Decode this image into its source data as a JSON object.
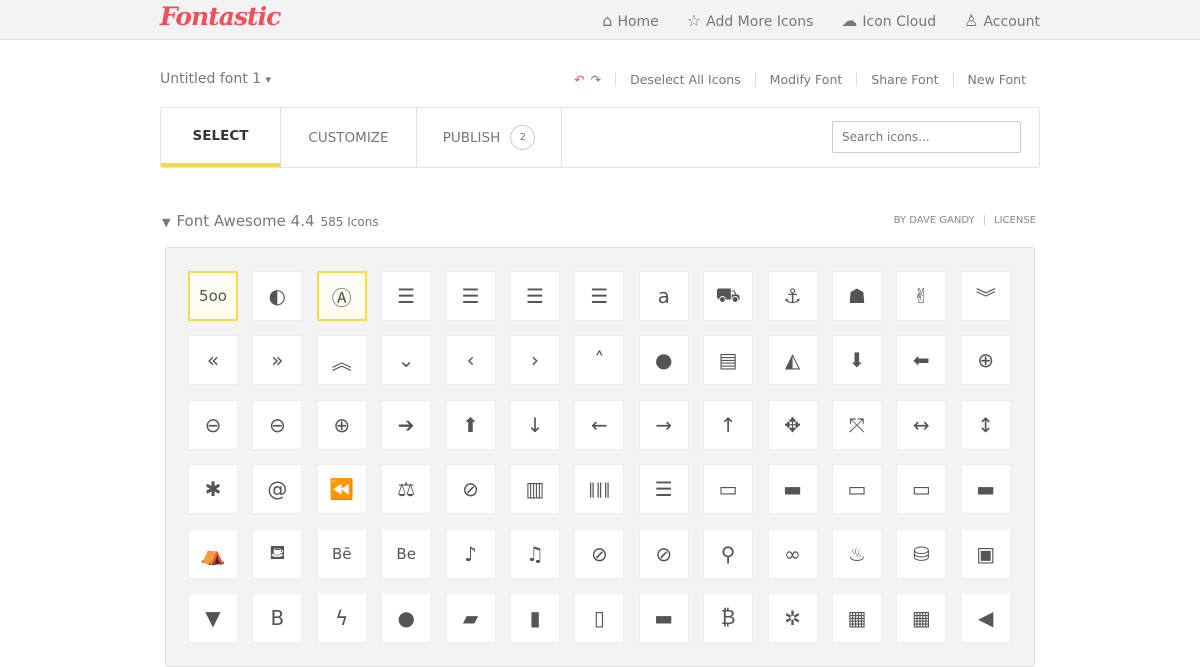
{
  "brand": {
    "logo": "Fontastic",
    "accent": "#f0505a",
    "highlight": "#f7d94c"
  },
  "nav": [
    {
      "icon": "home-icon",
      "glyph": "⌂",
      "label": "Home"
    },
    {
      "icon": "star-icon",
      "glyph": "☆",
      "label": "Add More Icons"
    },
    {
      "icon": "cloud-icon",
      "glyph": "☁",
      "label": "Icon Cloud"
    },
    {
      "icon": "user-icon",
      "glyph": "♙",
      "label": "Account"
    }
  ],
  "font": {
    "name": "Untitled font 1",
    "caret": "▾"
  },
  "actions": {
    "undo": "↶",
    "redo": "↷",
    "items": [
      "Deselect All Icons",
      "Modify Font",
      "Share Font",
      "New Font"
    ]
  },
  "tabs": [
    {
      "label": "SELECT"
    },
    {
      "label": "CUSTOMIZE"
    },
    {
      "label": "PUBLISH",
      "badge": "2"
    }
  ],
  "search": {
    "placeholder": "Search icons..."
  },
  "set": {
    "caret": "▼",
    "title": "Font Awesome 4.4",
    "count": "585 Icons",
    "author": "BY DAVE GANDY",
    "license": "LICENSE"
  },
  "icons": [
    {
      "n": "500px",
      "g": "5oo",
      "s": true
    },
    {
      "n": "adjust",
      "g": "◐"
    },
    {
      "n": "adn",
      "g": "Ⓐ",
      "s": true
    },
    {
      "n": "align-center",
      "g": "☰"
    },
    {
      "n": "align-justify",
      "g": "☰"
    },
    {
      "n": "align-left",
      "g": "☰"
    },
    {
      "n": "align-right",
      "g": "☰"
    },
    {
      "n": "amazon",
      "g": "a"
    },
    {
      "n": "ambulance",
      "g": "⛟"
    },
    {
      "n": "anchor",
      "g": "⚓"
    },
    {
      "n": "android",
      "g": "☗"
    },
    {
      "n": "angellist",
      "g": "✌"
    },
    {
      "n": "angle-double-down",
      "g": "︾"
    },
    {
      "n": "angle-double-left",
      "g": "«"
    },
    {
      "n": "angle-double-right",
      "g": "»"
    },
    {
      "n": "angle-double-up",
      "g": "︽"
    },
    {
      "n": "angle-down",
      "g": "⌄"
    },
    {
      "n": "angle-left",
      "g": "‹"
    },
    {
      "n": "angle-right",
      "g": "›"
    },
    {
      "n": "angle-up",
      "g": "˄"
    },
    {
      "n": "apple",
      "g": "●"
    },
    {
      "n": "archive",
      "g": "▤"
    },
    {
      "n": "area-chart",
      "g": "◭"
    },
    {
      "n": "arrow-circle-down",
      "g": "⬇"
    },
    {
      "n": "arrow-circle-left",
      "g": "⬅"
    },
    {
      "n": "arrow-circle-o-down",
      "g": "⊕"
    },
    {
      "n": "arrow-circle-o-left",
      "g": "⊖"
    },
    {
      "n": "arrow-circle-o-right",
      "g": "⊖"
    },
    {
      "n": "arrow-circle-o-up",
      "g": "⊕"
    },
    {
      "n": "arrow-circle-right",
      "g": "➔"
    },
    {
      "n": "arrow-circle-up",
      "g": "⬆"
    },
    {
      "n": "arrow-down",
      "g": "↓"
    },
    {
      "n": "arrow-left",
      "g": "←"
    },
    {
      "n": "arrow-right",
      "g": "→"
    },
    {
      "n": "arrow-up",
      "g": "↑"
    },
    {
      "n": "arrows",
      "g": "✥"
    },
    {
      "n": "arrows-alt",
      "g": "⤧"
    },
    {
      "n": "arrows-h",
      "g": "↔"
    },
    {
      "n": "arrows-v",
      "g": "↕"
    },
    {
      "n": "asterisk",
      "g": "✱"
    },
    {
      "n": "at",
      "g": "@"
    },
    {
      "n": "backward",
      "g": "⏪"
    },
    {
      "n": "balance-scale",
      "g": "⚖"
    },
    {
      "n": "ban",
      "g": "⊘"
    },
    {
      "n": "bar-chart",
      "g": "▥"
    },
    {
      "n": "barcode",
      "g": "‖‖‖"
    },
    {
      "n": "bars",
      "g": "☰"
    },
    {
      "n": "battery-empty",
      "g": "▭"
    },
    {
      "n": "battery-full",
      "g": "▬"
    },
    {
      "n": "battery-half",
      "g": "▭"
    },
    {
      "n": "battery-quarter",
      "g": "▭"
    },
    {
      "n": "battery-three-quarters",
      "g": "▬"
    },
    {
      "n": "bed",
      "g": "⛺"
    },
    {
      "n": "beer",
      "g": "⛾"
    },
    {
      "n": "behance",
      "g": "Bē"
    },
    {
      "n": "behance-square",
      "g": "Be"
    },
    {
      "n": "bell",
      "g": "♪"
    },
    {
      "n": "bell-o",
      "g": "♫"
    },
    {
      "n": "bell-slash",
      "g": "⊘"
    },
    {
      "n": "bell-slash-o",
      "g": "⊘"
    },
    {
      "n": "bicycle",
      "g": "⚲"
    },
    {
      "n": "binoculars",
      "g": "∞"
    },
    {
      "n": "birthday-cake",
      "g": "♨"
    },
    {
      "n": "bitbucket",
      "g": "⛁"
    },
    {
      "n": "bitbucket-square",
      "g": "▣"
    },
    {
      "n": "black-tie",
      "g": "▼"
    },
    {
      "n": "bold",
      "g": "B"
    },
    {
      "n": "bolt",
      "g": "ϟ"
    },
    {
      "n": "bomb",
      "g": "●"
    },
    {
      "n": "book",
      "g": "▰"
    },
    {
      "n": "bookmark",
      "g": "▮"
    },
    {
      "n": "bookmark-o",
      "g": "▯"
    },
    {
      "n": "briefcase",
      "g": "▬"
    },
    {
      "n": "btc",
      "g": "₿"
    },
    {
      "n": "bug",
      "g": "✲"
    },
    {
      "n": "building",
      "g": "▦"
    },
    {
      "n": "building-o",
      "g": "▦"
    },
    {
      "n": "bullhorn",
      "g": "◀"
    }
  ]
}
